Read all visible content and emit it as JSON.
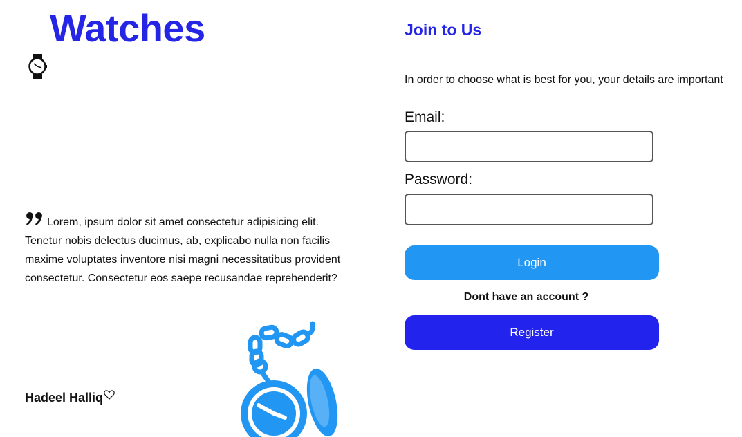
{
  "brand": {
    "title": "Watches",
    "icon": "wristwatch-icon"
  },
  "testimonial": {
    "quote_icon": "quote-icon",
    "text": "Lorem, ipsum dolor sit amet consectetur adipisicing elit. Tenetur nobis delectus ducimus, ab, explicabo nulla non facilis maxime voluptates inventore nisi magni necessitatibus provident consectetur. Consectetur eos saepe recusandae reprehenderit?",
    "author": "Hadeel Halliq",
    "author_icon": "heart-icon",
    "illustration": "pocket-watch-icon"
  },
  "form": {
    "title": "Join to Us",
    "intro": "In order to choose what is best for you, your details are important",
    "email_label": "Email:",
    "email_value": "",
    "password_label": "Password:",
    "password_value": "",
    "login_label": "Login",
    "no_account_text": "Dont have an account ?",
    "register_label": "Register"
  },
  "colors": {
    "brand_blue": "#2525e6",
    "login_blue": "#2196f3",
    "register_blue": "#2323ee"
  }
}
